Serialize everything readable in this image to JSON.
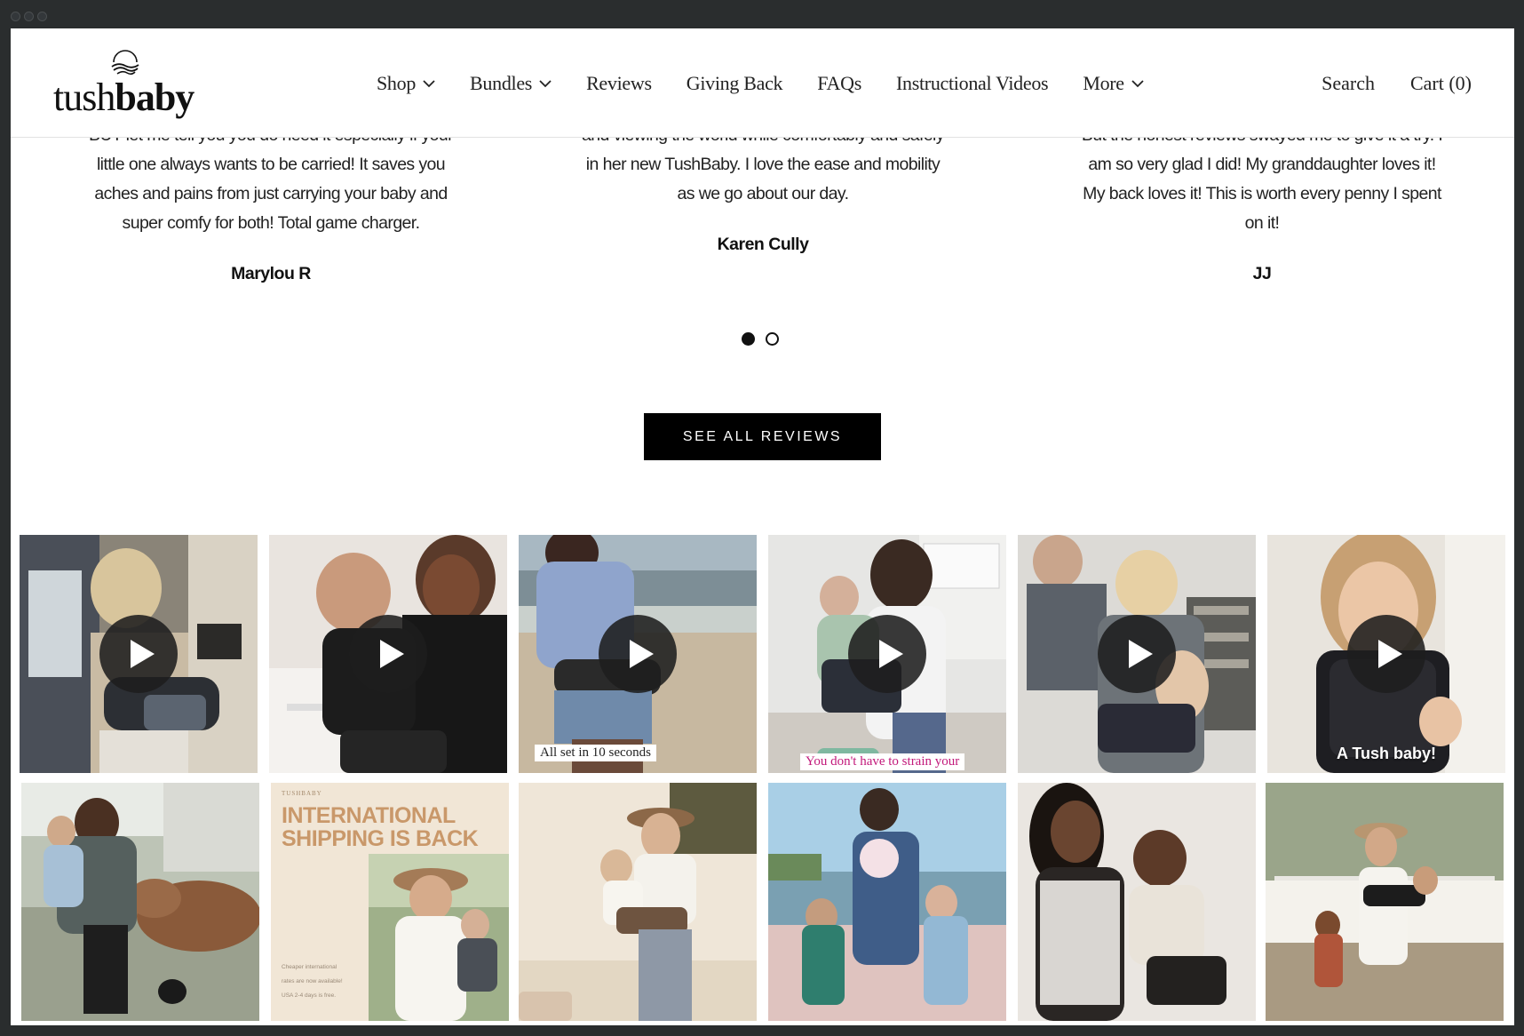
{
  "brand": {
    "logo_light": "tush",
    "logo_bold": "baby"
  },
  "nav": {
    "shop": "Shop",
    "bundles": "Bundles",
    "reviews": "Reviews",
    "giving_back": "Giving Back",
    "faqs": "FAQs",
    "videos": "Instructional Videos",
    "more": "More"
  },
  "header_right": {
    "search": "Search",
    "cart": "Cart (0)"
  },
  "reviews": [
    {
      "partial": "BUT let me tell you you do need it especially if your",
      "lines": [
        "little one always wants to be carried! It saves you",
        "aches and pains from just carrying your baby and",
        "super comfy for both! Total game charger."
      ],
      "author": "Marylou R"
    },
    {
      "partial": "and viewing the world while comfortably and safely",
      "lines": [
        "in her new TushBaby. I love the ease and mobility",
        "as we go about our day."
      ],
      "author": "Karen Cully"
    },
    {
      "partial": "But the honest reviews swayed me to give it a try. I",
      "lines": [
        "am so very glad I did! My granddaughter loves it!",
        "My back loves it! This is worth every penny I spent",
        "on it!"
      ],
      "author": "JJ"
    }
  ],
  "pagination": {
    "total": 2,
    "active": 1
  },
  "cta": {
    "see_all": "SEE ALL REVIEWS"
  },
  "gallery": {
    "captions": {
      "tile3": "All set in 10 seconds",
      "tile4": "You don't have to strain your",
      "tile6": "A Tush baby!"
    },
    "promo": {
      "brand": "TUSHBABY",
      "title": "INTERNATIONAL SHIPPING IS BACK",
      "small_lines": [
        "Cheaper international",
        "rates are now available!",
        "USA 2-4 days is free."
      ]
    }
  },
  "colors": {
    "button_bg": "#000000",
    "promo_text": "#c9986a",
    "caption_pink": "#c2187a"
  }
}
